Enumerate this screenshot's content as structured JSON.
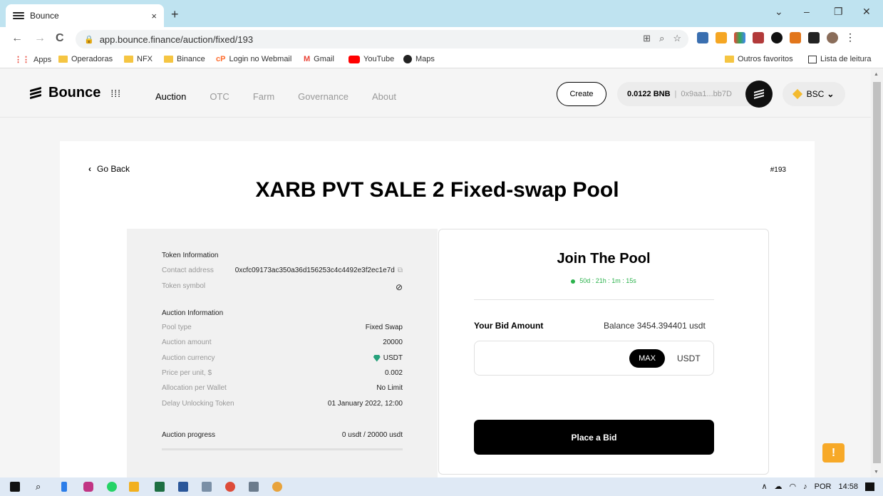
{
  "browser": {
    "tab_title": "Bounce",
    "tab_close": "×",
    "new_tab": "+",
    "url": "app.bounce.finance/auction/fixed/193",
    "nav_back": "←",
    "nav_forward": "→",
    "nav_reload": "C",
    "win_minimize": "–",
    "win_restore": "❐",
    "win_close": "✕",
    "win_chevron": "⌄",
    "bookmarks": [
      {
        "label": "Apps"
      },
      {
        "label": "Operadoras"
      },
      {
        "label": "NFX"
      },
      {
        "label": "Binance"
      },
      {
        "label": "Login no Webmail"
      },
      {
        "label": "Gmail"
      },
      {
        "label": "YouTube"
      },
      {
        "label": "Maps"
      }
    ],
    "bookmarks_right": [
      {
        "label": "Outros favoritos"
      },
      {
        "label": "Lista de leitura"
      }
    ]
  },
  "header": {
    "brand": "Bounce",
    "nav": [
      {
        "label": "Auction",
        "active": true
      },
      {
        "label": "OTC"
      },
      {
        "label": "Farm"
      },
      {
        "label": "Governance"
      },
      {
        "label": "About"
      }
    ],
    "create_label": "Create",
    "wallet_balance": "0.0122 BNB",
    "wallet_sep": "|",
    "wallet_address": "0x9aa1...bb7D",
    "chain": "BSC"
  },
  "pool": {
    "go_back": "Go Back",
    "pool_id": "#193",
    "title": "XARB PVT SALE 2 Fixed-swap Pool",
    "token_info_heading": "Token Information",
    "contract_label": "Contact address",
    "contract_value": "0xcfc09173ac350a36d156253c4c4492e3f2ec1e7d",
    "token_symbol_label": "Token symbol",
    "auction_info_heading": "Auction Information",
    "rows": [
      {
        "label": "Pool type",
        "value": "Fixed Swap"
      },
      {
        "label": "Auction amount",
        "value": "20000"
      },
      {
        "label": "Auction currency",
        "value": "USDT"
      },
      {
        "label": "Price per unit, $",
        "value": "0.002"
      },
      {
        "label": "Allocation per Wallet",
        "value": "No Limit"
      },
      {
        "label": "Delay Unlocking Token",
        "value": "01 January 2022, 12:00"
      }
    ],
    "progress_label": "Auction progress",
    "progress_value": "0 usdt / 20000 usdt",
    "progress_fraction": 0
  },
  "join": {
    "title": "Join The Pool",
    "countdown": "50d : 21h : 1m : 15s",
    "bid_label": "Your Bid Amount",
    "balance": "Balance 3454.394401 usdt",
    "max_label": "MAX",
    "unit": "USDT",
    "place_bid": "Place a Bid"
  },
  "taskbar": {
    "lang": "POR",
    "time": "14:58"
  },
  "colors": {
    "accent_green": "#2bb24c",
    "bnb": "#f3ba2f",
    "feedback": "#f7a928"
  }
}
